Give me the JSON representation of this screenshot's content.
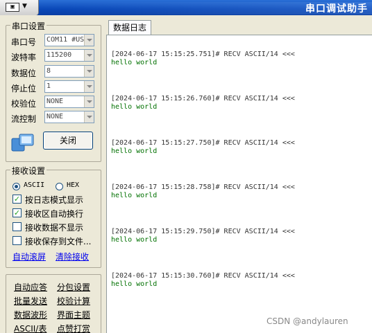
{
  "window": {
    "title": "串口调试助手"
  },
  "serial_settings": {
    "legend": "串口设置",
    "fields": [
      {
        "label": "串口号",
        "value": "COM11 #US"
      },
      {
        "label": "波特率",
        "value": "115200"
      },
      {
        "label": "数据位",
        "value": "8"
      },
      {
        "label": "停止位",
        "value": "1"
      },
      {
        "label": "校验位",
        "value": "NONE"
      },
      {
        "label": "流控制",
        "value": "NONE"
      }
    ],
    "close_label": "关闭"
  },
  "receive_settings": {
    "legend": "接收设置",
    "mode_ascii": "ASCII",
    "mode_hex": "HEX",
    "options": [
      {
        "label": "按日志模式显示",
        "checked": true
      },
      {
        "label": "接收区自动换行",
        "checked": true
      },
      {
        "label": "接收数据不显示",
        "checked": false
      },
      {
        "label": "接收保存到文件...",
        "checked": false
      }
    ],
    "auto_scroll": "自动滚屏",
    "clear_receive": "清除接收"
  },
  "tools": {
    "items": [
      "自动应答",
      "分包设置",
      "批量发送",
      "校验计算",
      "数据波形",
      "界面主题",
      "ASCII/表",
      "点赞打赏"
    ]
  },
  "log": {
    "tab_label": "数据日志",
    "entries": [
      {
        "header": "[2024-06-17 15:15:25.751]# RECV ASCII/14 <<<",
        "body": "hello world"
      },
      {
        "header": "[2024-06-17 15:15:26.760]# RECV ASCII/14 <<<",
        "body": "hello world"
      },
      {
        "header": "[2024-06-17 15:15:27.750]# RECV ASCII/14 <<<",
        "body": "hello world"
      },
      {
        "header": "[2024-06-17 15:15:28.758]# RECV ASCII/14 <<<",
        "body": "hello world"
      },
      {
        "header": "[2024-06-17 15:15:29.750]# RECV ASCII/14 <<<",
        "body": "hello world"
      },
      {
        "header": "[2024-06-17 15:15:30.760]# RECV ASCII/14 <<<",
        "body": "hello world"
      }
    ]
  },
  "watermark": "CSDN @andylauren"
}
